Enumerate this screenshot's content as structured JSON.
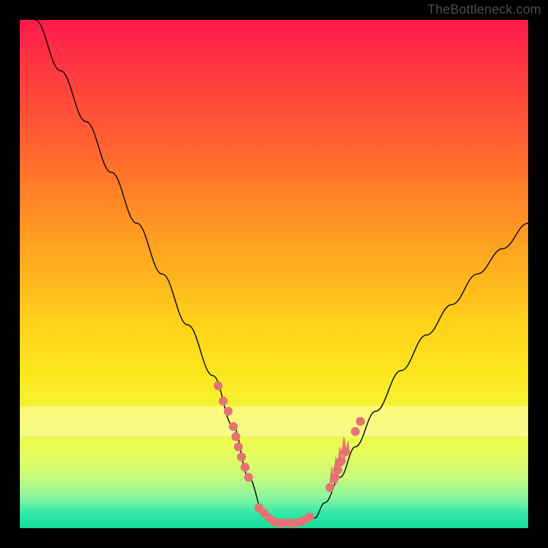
{
  "watermark": "TheBottleneck.com",
  "chart_data": {
    "type": "line",
    "title": "",
    "xlabel": "",
    "ylabel": "",
    "xlim": [
      0,
      100
    ],
    "ylim": [
      0,
      100
    ],
    "legend": false,
    "grid": false,
    "background_gradient": {
      "top_color": "#ff1a4d",
      "bottom_color": "#15dd9e"
    },
    "highlight_band_y": [
      18,
      24
    ],
    "series": [
      {
        "name": "bottleneck-curve",
        "color": "#111111",
        "x": [
          3,
          8,
          13,
          18,
          23,
          28,
          33,
          38,
          42,
          45,
          48,
          50,
          52,
          55,
          58,
          60,
          63,
          66,
          70,
          75,
          80,
          85,
          90,
          95,
          100
        ],
        "values": [
          100,
          90,
          80,
          70,
          60,
          50,
          40,
          30,
          20,
          10,
          3,
          1,
          1,
          1,
          2,
          5,
          10,
          16,
          23,
          31,
          38,
          44,
          50,
          55,
          60
        ]
      }
    ],
    "marker_clusters": [
      {
        "name": "left-cluster",
        "color": "#e57373",
        "points": [
          {
            "x": 39,
            "y": 28
          },
          {
            "x": 40,
            "y": 25
          },
          {
            "x": 41,
            "y": 23
          },
          {
            "x": 42,
            "y": 20
          },
          {
            "x": 42.5,
            "y": 18
          },
          {
            "x": 43,
            "y": 16
          },
          {
            "x": 43.6,
            "y": 14
          },
          {
            "x": 44.3,
            "y": 12
          },
          {
            "x": 45,
            "y": 10
          }
        ]
      },
      {
        "name": "bottom-cluster",
        "color": "#e57373",
        "points": [
          {
            "x": 47,
            "y": 4
          },
          {
            "x": 48,
            "y": 3
          },
          {
            "x": 49,
            "y": 2
          },
          {
            "x": 50,
            "y": 1.3
          },
          {
            "x": 51,
            "y": 1
          },
          {
            "x": 52,
            "y": 1
          },
          {
            "x": 53,
            "y": 1
          },
          {
            "x": 54,
            "y": 1
          },
          {
            "x": 55,
            "y": 1.2
          },
          {
            "x": 56,
            "y": 1.6
          },
          {
            "x": 57,
            "y": 2.2
          }
        ]
      },
      {
        "name": "right-cluster",
        "color": "#e57373",
        "points": [
          {
            "x": 61,
            "y": 8
          },
          {
            "x": 62,
            "y": 10
          },
          {
            "x": 62.5,
            "y": 11.5
          },
          {
            "x": 63,
            "y": 13
          },
          {
            "x": 64,
            "y": 15
          },
          {
            "x": 66,
            "y": 19
          },
          {
            "x": 67,
            "y": 21
          }
        ]
      }
    ],
    "right_spikes": {
      "color": "#e57373",
      "base_points": [
        {
          "x": 61.5,
          "y": 9
        },
        {
          "x": 62.3,
          "y": 11
        },
        {
          "x": 63.1,
          "y": 13
        },
        {
          "x": 63.9,
          "y": 15
        }
      ],
      "spike_height": 3
    }
  }
}
